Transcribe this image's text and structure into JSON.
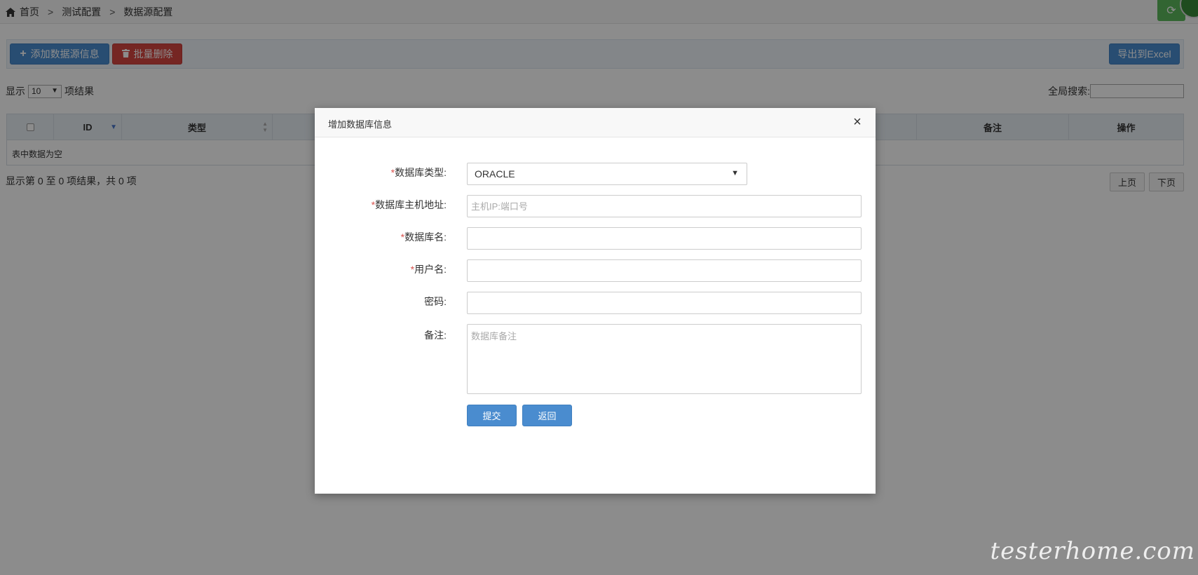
{
  "breadcrumb": {
    "home": "首页",
    "sep": ">",
    "level1": "测试配置",
    "level2": "数据源配置"
  },
  "toolbar": {
    "add_label": "添加数据源信息",
    "delete_label": "批量删除",
    "export_label": "导出到Excel"
  },
  "length_menu": {
    "prefix": "显示",
    "value": "10",
    "suffix": "项结果"
  },
  "search": {
    "label": "全局搜索:"
  },
  "table": {
    "columns": [
      "ID",
      "类型",
      "备注",
      "操作"
    ],
    "empty_text": "表中数据为空"
  },
  "info": {
    "text": "显示第 0 至 0 项结果，共 0 项"
  },
  "pager": {
    "prev": "上页",
    "next": "下页"
  },
  "modal": {
    "title": "增加数据库信息",
    "close": "×",
    "fields": {
      "db_type": {
        "label": "数据库类型:",
        "value": "ORACLE"
      },
      "host": {
        "label": "数据库主机地址:",
        "placeholder": "主机IP:端口号"
      },
      "db_name": {
        "label": "数据库名:"
      },
      "username": {
        "label": "用户名:"
      },
      "password": {
        "label": "密码:"
      },
      "remark": {
        "label": "备注:",
        "placeholder": "数据库备注"
      }
    },
    "submit_label": "提交",
    "back_label": "返回"
  },
  "required_mark": "*",
  "watermark": "testerhome.com",
  "colors": {
    "primary": "#4a8ccf",
    "danger": "#d64541",
    "success": "#5cb85c",
    "required": "#d9534f"
  }
}
